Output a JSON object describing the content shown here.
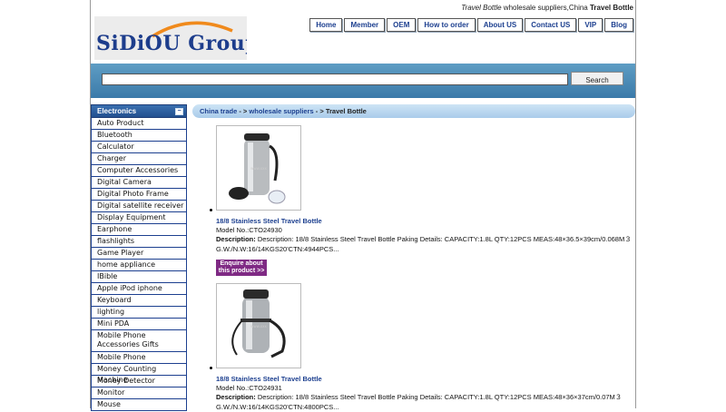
{
  "top_tag": {
    "product": "Travel Bottle",
    "middle": "wholesale suppliers,China",
    "product_bold": "Travel Bottle"
  },
  "logo": {
    "text": "SiDiOU Group",
    "reg": "®"
  },
  "nav": [
    "Home",
    "Member",
    "OEM",
    "How to order",
    "About US",
    "Contact US",
    "VIP",
    "Blog"
  ],
  "search": {
    "value": "",
    "button": "Search"
  },
  "sidebar": {
    "header": "Electronics",
    "collapse": "−",
    "items": [
      "Auto Product",
      "Bluetooth",
      "Calculator",
      "Charger",
      "Computer Accessories",
      "Digital Camera",
      "Digital Photo Frame",
      "Digital satellite receiver",
      "Display Equipment",
      "Earphone",
      "flashlights",
      "Game Player",
      "home appliance",
      "IBible",
      "Apple iPod iphone",
      "Keyboard",
      "lighting",
      "Mini PDA",
      "Mobile Phone Accessories Gifts",
      "Mobile Phone",
      "Money Counting Machine",
      "Money Detector",
      "Monitor",
      "Mouse"
    ]
  },
  "breadcrumb": {
    "home": "China trade",
    "sep1": " - > ",
    "category": "wholesale suppliers",
    "sep2": " - > ",
    "current": "Travel Bottle"
  },
  "products": [
    {
      "name": "18/8 Stainless Steel Travel Bottle",
      "model": "Model No.:CTO24930",
      "desc_label": "Description:",
      "desc": " Description:  18/8 Stainless Steel Travel Bottle Paking Details: CAPACITY:1.8L QTY:12PCS MEAS:48×36.5×39cm/0.068M３ G.W./N.W:16/14KGS20'CTN:4944PCS...",
      "enquire": "Enquire about this product >>"
    },
    {
      "name": "18/8 Stainless Steel Travel Bottle",
      "model": "Model No.:CTO24931",
      "desc_label": "Description:",
      "desc": " Description:  18/8 Stainless Steel Travel Bottle Paking Details: CAPACITY:1.8L QTY:12PCS MEAS:48×36×37cm/0.07M３ G.W./N.W:16/14KGS20'CTN:4800PCS...",
      "enquire": ""
    }
  ],
  "colors": {
    "nav_text": "#1c3f8f",
    "search_bar": "#4a88b6",
    "enquire_bg": "#7f2a84",
    "breadcrumb_bg": "#b9d6ee"
  }
}
